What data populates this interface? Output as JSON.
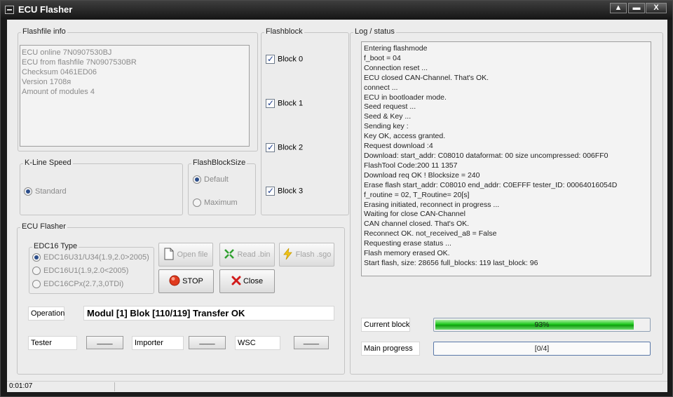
{
  "window": {
    "title": "ECU Flasher",
    "minimize": "▲",
    "restore": "▬",
    "close": "X"
  },
  "flashfile_info": {
    "label": "Flashfile info",
    "lines": [
      "ECU online 7N0907530BJ",
      "ECU from flashfile 7N0907530BR",
      "Checksum 0461ED06",
      "Version 1708я",
      "Amount of modules 4"
    ]
  },
  "flashblock": {
    "label": "Flashblock",
    "blocks": [
      {
        "label": "Block 0",
        "checked": true
      },
      {
        "label": "Block 1",
        "checked": true
      },
      {
        "label": "Block 2",
        "checked": true
      },
      {
        "label": "Block 3",
        "checked": true
      }
    ]
  },
  "kline_speed": {
    "label": "K-Line Speed",
    "option": "Standard"
  },
  "flashblocksize": {
    "label": "FlashBlockSize",
    "options": [
      "Default",
      "Maximum"
    ],
    "selected": "Default"
  },
  "ecu_flasher": {
    "label": "ECU Flasher",
    "edc16_type": {
      "label": "EDC16 Type",
      "options": [
        "EDC16U31/U34(1.9,2.0>2005)",
        "EDC16U1(1.9,2.0<2005)",
        "EDC16CPx(2.7,3,0TDi)"
      ],
      "selected": "EDC16U31/U34(1.9,2.0>2005)"
    },
    "buttons": {
      "open_file": "Open file",
      "read_bin": "Read .bin",
      "flash_sgo": "Flash .sgo",
      "stop": "STOP",
      "close": "Close"
    },
    "operation_label": "Operation",
    "operation_value": "Modul [1] Blok [110/119] Transfer OK",
    "tester_label": "Tester",
    "tester_value": "____",
    "importer_label": "Importer",
    "importer_value": "____",
    "wsc_label": "WSC",
    "wsc_value": "____"
  },
  "log": {
    "label": "Log / status",
    "lines": [
      "Entering flashmode",
      "f_boot = 04",
      "Connection reset ...",
      "ECU closed CAN-Channel. That's OK.",
      "connect ...",
      "ECU in bootloader mode.",
      "Seed request ...",
      "Seed & Key ...",
      "Sending key :",
      "Key OK, access granted.",
      "Request download :4",
      "Download: start_addr: C08010 dataformat: 00 size uncompressed: 006FF0",
      "FlashTool Code:200 11 1357",
      "Download req OK ! Blocksize = 240",
      "Erase flash start_addr: C08010 end_addr: C0EFFF tester_ID: 00064016054D",
      "f_routine = 02, T_Routine= 20[s]",
      "Erasing initiated, reconnect in progress ...",
      "Waiting for close CAN-Channel",
      "CAN channel closed. That's OK.",
      "Reconnect OK. not_received_a8 = False",
      "Requesting erase status ...",
      "Flash memory erased OK.",
      "Start flash, size: 28656 full_blocks: 119 last_block: 96"
    ],
    "current_block_label": "Current block",
    "current_block_text": "93%",
    "current_block_fraction": 0.93,
    "main_progress_label": "Main progress",
    "main_progress_text": "[0/4]",
    "main_progress_fraction": 0
  },
  "status": {
    "time": "0:01:07"
  },
  "colors": {
    "progress_green": "#1fc81f",
    "stop_red": "#e03a1e",
    "close_red": "#d11a1a"
  }
}
